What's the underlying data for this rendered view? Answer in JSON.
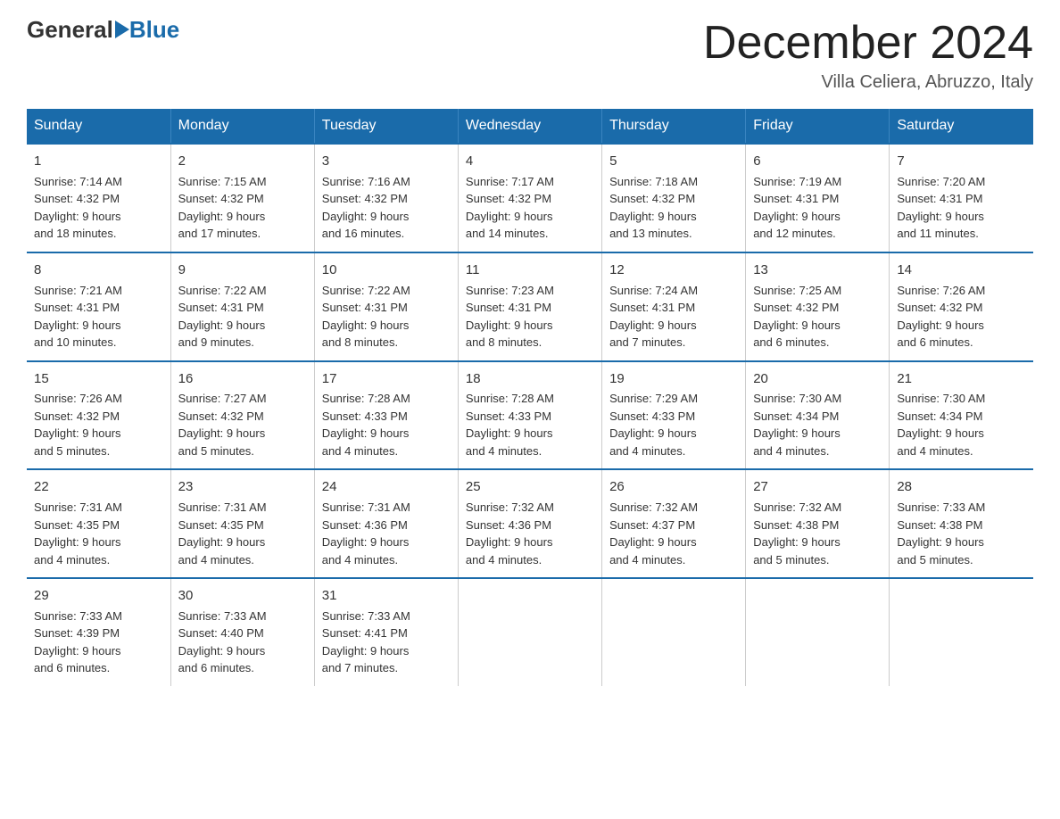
{
  "header": {
    "logo_general": "General",
    "logo_blue": "Blue",
    "month_title": "December 2024",
    "location": "Villa Celiera, Abruzzo, Italy"
  },
  "weekdays": [
    "Sunday",
    "Monday",
    "Tuesday",
    "Wednesday",
    "Thursday",
    "Friday",
    "Saturday"
  ],
  "weeks": [
    [
      {
        "day": "1",
        "sunrise": "7:14 AM",
        "sunset": "4:32 PM",
        "daylight": "9 hours and 18 minutes."
      },
      {
        "day": "2",
        "sunrise": "7:15 AM",
        "sunset": "4:32 PM",
        "daylight": "9 hours and 17 minutes."
      },
      {
        "day": "3",
        "sunrise": "7:16 AM",
        "sunset": "4:32 PM",
        "daylight": "9 hours and 16 minutes."
      },
      {
        "day": "4",
        "sunrise": "7:17 AM",
        "sunset": "4:32 PM",
        "daylight": "9 hours and 14 minutes."
      },
      {
        "day": "5",
        "sunrise": "7:18 AM",
        "sunset": "4:32 PM",
        "daylight": "9 hours and 13 minutes."
      },
      {
        "day": "6",
        "sunrise": "7:19 AM",
        "sunset": "4:31 PM",
        "daylight": "9 hours and 12 minutes."
      },
      {
        "day": "7",
        "sunrise": "7:20 AM",
        "sunset": "4:31 PM",
        "daylight": "9 hours and 11 minutes."
      }
    ],
    [
      {
        "day": "8",
        "sunrise": "7:21 AM",
        "sunset": "4:31 PM",
        "daylight": "9 hours and 10 minutes."
      },
      {
        "day": "9",
        "sunrise": "7:22 AM",
        "sunset": "4:31 PM",
        "daylight": "9 hours and 9 minutes."
      },
      {
        "day": "10",
        "sunrise": "7:22 AM",
        "sunset": "4:31 PM",
        "daylight": "9 hours and 8 minutes."
      },
      {
        "day": "11",
        "sunrise": "7:23 AM",
        "sunset": "4:31 PM",
        "daylight": "9 hours and 8 minutes."
      },
      {
        "day": "12",
        "sunrise": "7:24 AM",
        "sunset": "4:31 PM",
        "daylight": "9 hours and 7 minutes."
      },
      {
        "day": "13",
        "sunrise": "7:25 AM",
        "sunset": "4:32 PM",
        "daylight": "9 hours and 6 minutes."
      },
      {
        "day": "14",
        "sunrise": "7:26 AM",
        "sunset": "4:32 PM",
        "daylight": "9 hours and 6 minutes."
      }
    ],
    [
      {
        "day": "15",
        "sunrise": "7:26 AM",
        "sunset": "4:32 PM",
        "daylight": "9 hours and 5 minutes."
      },
      {
        "day": "16",
        "sunrise": "7:27 AM",
        "sunset": "4:32 PM",
        "daylight": "9 hours and 5 minutes."
      },
      {
        "day": "17",
        "sunrise": "7:28 AM",
        "sunset": "4:33 PM",
        "daylight": "9 hours and 4 minutes."
      },
      {
        "day": "18",
        "sunrise": "7:28 AM",
        "sunset": "4:33 PM",
        "daylight": "9 hours and 4 minutes."
      },
      {
        "day": "19",
        "sunrise": "7:29 AM",
        "sunset": "4:33 PM",
        "daylight": "9 hours and 4 minutes."
      },
      {
        "day": "20",
        "sunrise": "7:30 AM",
        "sunset": "4:34 PM",
        "daylight": "9 hours and 4 minutes."
      },
      {
        "day": "21",
        "sunrise": "7:30 AM",
        "sunset": "4:34 PM",
        "daylight": "9 hours and 4 minutes."
      }
    ],
    [
      {
        "day": "22",
        "sunrise": "7:31 AM",
        "sunset": "4:35 PM",
        "daylight": "9 hours and 4 minutes."
      },
      {
        "day": "23",
        "sunrise": "7:31 AM",
        "sunset": "4:35 PM",
        "daylight": "9 hours and 4 minutes."
      },
      {
        "day": "24",
        "sunrise": "7:31 AM",
        "sunset": "4:36 PM",
        "daylight": "9 hours and 4 minutes."
      },
      {
        "day": "25",
        "sunrise": "7:32 AM",
        "sunset": "4:36 PM",
        "daylight": "9 hours and 4 minutes."
      },
      {
        "day": "26",
        "sunrise": "7:32 AM",
        "sunset": "4:37 PM",
        "daylight": "9 hours and 4 minutes."
      },
      {
        "day": "27",
        "sunrise": "7:32 AM",
        "sunset": "4:38 PM",
        "daylight": "9 hours and 5 minutes."
      },
      {
        "day": "28",
        "sunrise": "7:33 AM",
        "sunset": "4:38 PM",
        "daylight": "9 hours and 5 minutes."
      }
    ],
    [
      {
        "day": "29",
        "sunrise": "7:33 AM",
        "sunset": "4:39 PM",
        "daylight": "9 hours and 6 minutes."
      },
      {
        "day": "30",
        "sunrise": "7:33 AM",
        "sunset": "4:40 PM",
        "daylight": "9 hours and 6 minutes."
      },
      {
        "day": "31",
        "sunrise": "7:33 AM",
        "sunset": "4:41 PM",
        "daylight": "9 hours and 7 minutes."
      },
      null,
      null,
      null,
      null
    ]
  ],
  "labels": {
    "sunrise": "Sunrise:",
    "sunset": "Sunset:",
    "daylight": "Daylight:"
  }
}
